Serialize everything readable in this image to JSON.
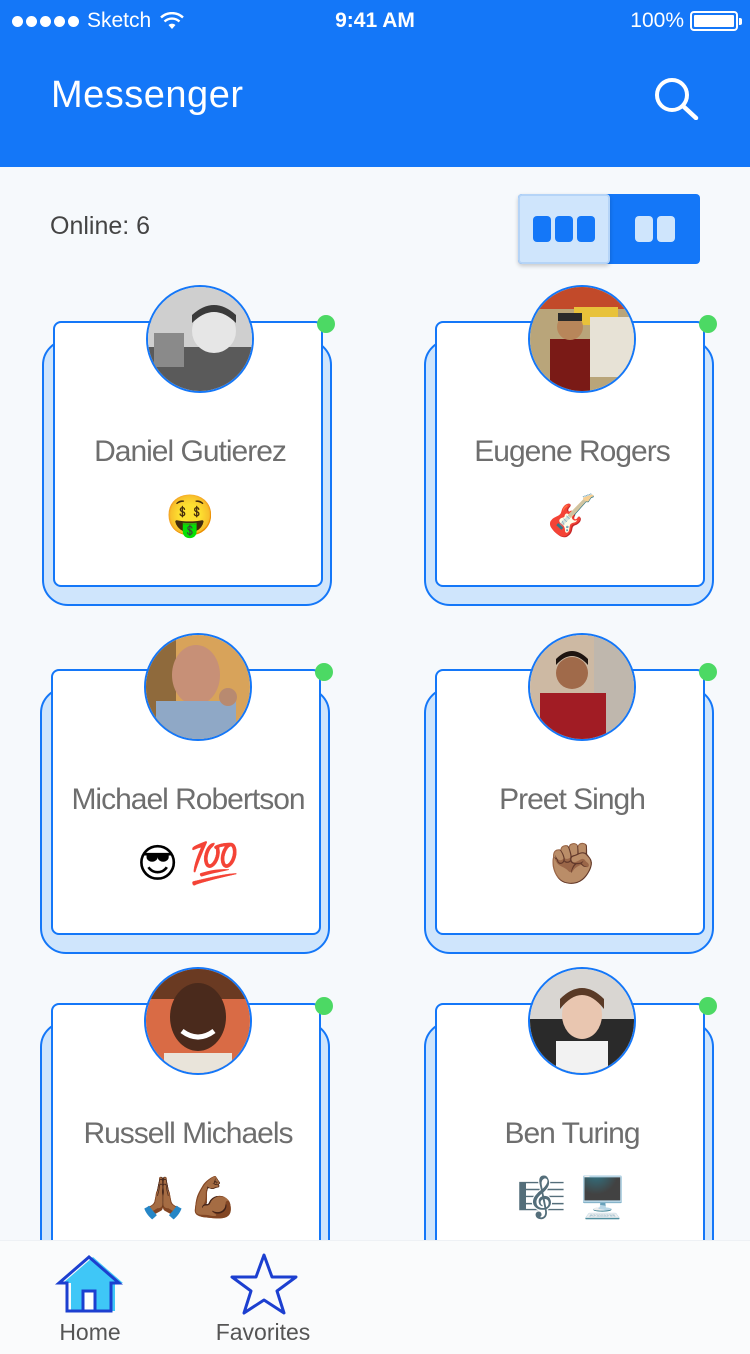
{
  "status_bar": {
    "carrier": "Sketch",
    "time": "9:41 AM",
    "battery": "100%"
  },
  "nav": {
    "title": "Messenger",
    "search_icon": "search-icon"
  },
  "online": {
    "label": "Online: 6"
  },
  "view_toggle": {
    "options": [
      "three-column",
      "two-column"
    ],
    "selected": "three-column"
  },
  "contacts": [
    {
      "name": "Daniel Gutierez",
      "emoji": "🤑",
      "online": true
    },
    {
      "name": "Eugene Rogers",
      "emoji": "🎸",
      "online": true
    },
    {
      "name": "Michael Robertson",
      "emoji": "😎 💯",
      "online": true
    },
    {
      "name": "Preet Singh",
      "emoji": "✊🏽",
      "online": true
    },
    {
      "name": "Russell Michaels",
      "emoji": "🙏🏾💪🏾",
      "online": true
    },
    {
      "name": "Ben Turing",
      "emoji": "🎼 🖥️",
      "online": true
    }
  ],
  "tabbar": {
    "items": [
      {
        "label": "Home",
        "icon": "home-icon"
      },
      {
        "label": "Favorites",
        "icon": "star-icon"
      }
    ]
  },
  "colors": {
    "primary": "#1477f8",
    "card_back": "#cfe5fc",
    "online_dot": "#4cd964"
  }
}
